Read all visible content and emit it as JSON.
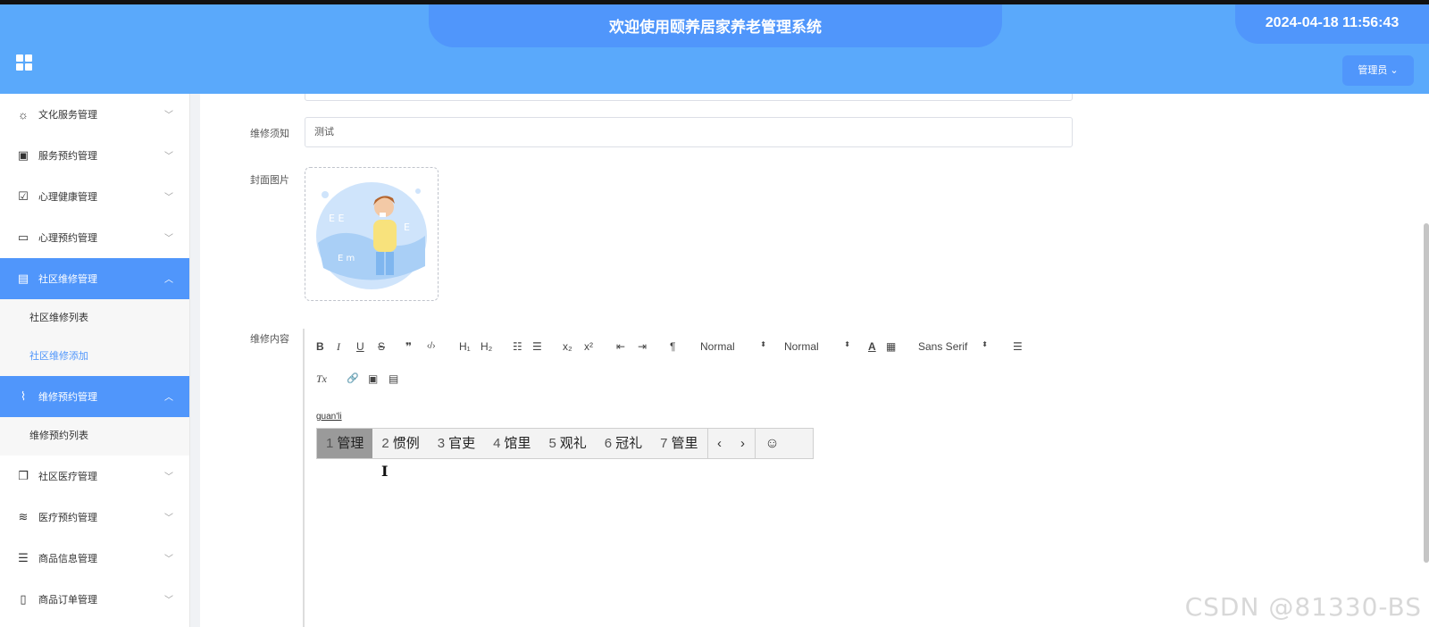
{
  "header": {
    "title": "欢迎使用颐养居家养老管理系统",
    "datetime": "2024-04-18 11:56:43",
    "user_menu": "管理员",
    "apps_icon": "apps-grid-icon"
  },
  "sidebar": {
    "items": [
      {
        "label": "文化服务管理",
        "icon": "sun-icon",
        "glyph": "☼"
      },
      {
        "label": "服务预约管理",
        "icon": "inbox-icon",
        "glyph": "▣"
      },
      {
        "label": "心理健康管理",
        "icon": "clipboard-check-icon",
        "glyph": "☑"
      },
      {
        "label": "心理预约管理",
        "icon": "message-icon",
        "glyph": "▭"
      },
      {
        "label": "社区维修管理",
        "icon": "archive-icon",
        "glyph": "▤",
        "active": true,
        "children": [
          "社区维修列表",
          "社区维修添加"
        ],
        "selected_child": 1
      },
      {
        "label": "维修预约管理",
        "icon": "paperclip-icon",
        "glyph": "⌇",
        "active": true,
        "children": [
          "维修预约列表"
        ]
      },
      {
        "label": "社区医疗管理",
        "icon": "copy-icon",
        "glyph": "❐"
      },
      {
        "label": "医疗预约管理",
        "icon": "sliders-icon",
        "glyph": "≋"
      },
      {
        "label": "商品信息管理",
        "icon": "list-icon",
        "glyph": "☰"
      },
      {
        "label": "商品订单管理",
        "icon": "phone-icon",
        "glyph": "▯"
      }
    ]
  },
  "form": {
    "notice_label": "维修须知",
    "notice_value": "测试",
    "cover_label": "封面图片",
    "content_label": "维修内容"
  },
  "editor": {
    "toolbar_row1": [
      "B",
      "I",
      "U",
      "S",
      "❞",
      "‹/›",
      "H₁",
      "H₂",
      "☷",
      "☰",
      "x₂",
      "x²",
      "⇤",
      "⇥",
      "¶",
      "Normal",
      "Normal",
      "A",
      "▦",
      "Sans Serif",
      "☰"
    ],
    "toolbar_row2": [
      "Tx",
      "🔗",
      "▣",
      "▤"
    ],
    "size_select": "Normal",
    "header_select": "Normal",
    "font_select": "Sans Serif"
  },
  "ime": {
    "composition": "guan'li",
    "candidates": [
      {
        "n": "1",
        "text": "管理"
      },
      {
        "n": "2",
        "text": "惯例"
      },
      {
        "n": "3",
        "text": "官吏"
      },
      {
        "n": "4",
        "text": "馆里"
      },
      {
        "n": "5",
        "text": "观礼"
      },
      {
        "n": "6",
        "text": "冠礼"
      },
      {
        "n": "7",
        "text": "管里"
      }
    ],
    "prev": "‹",
    "next": "›",
    "emoji": "☺"
  },
  "watermark": "CSDN @81330-BS"
}
